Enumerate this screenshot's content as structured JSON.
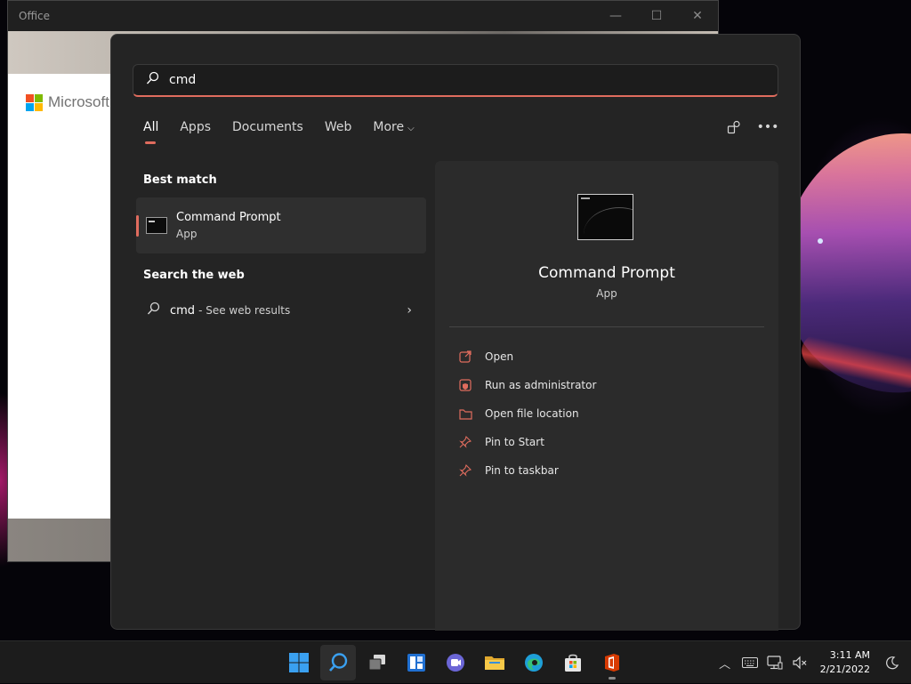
{
  "office_window": {
    "title": "Office",
    "brand": "Microsoft",
    "logo_colors": [
      "#f25022",
      "#7fba00",
      "#00a4ef",
      "#ffb900"
    ]
  },
  "search": {
    "query": "cmd",
    "tabs": [
      {
        "label": "All",
        "active": true
      },
      {
        "label": "Apps",
        "active": false
      },
      {
        "label": "Documents",
        "active": false
      },
      {
        "label": "Web",
        "active": false
      },
      {
        "label": "More",
        "active": false
      }
    ],
    "top_icons": [
      "share-icon",
      "more-options-icon"
    ],
    "best_match": {
      "heading": "Best match",
      "name": "Command Prompt",
      "type": "App",
      "icon": "command-prompt-icon"
    },
    "web": {
      "heading": "Search the web",
      "query": "cmd",
      "suffix": "- See web results"
    },
    "detail": {
      "name": "Command Prompt",
      "type": "App",
      "actions": [
        {
          "label": "Open",
          "icon": "open-icon"
        },
        {
          "label": "Run as administrator",
          "icon": "admin-shield-icon"
        },
        {
          "label": "Open file location",
          "icon": "folder-icon"
        },
        {
          "label": "Pin to Start",
          "icon": "pin-icon"
        },
        {
          "label": "Pin to taskbar",
          "icon": "pin-icon"
        }
      ]
    },
    "accent_color": "#e06c5e"
  },
  "taskbar": {
    "apps": [
      {
        "name": "start-button",
        "icon": "windows-icon"
      },
      {
        "name": "search-button",
        "icon": "search-icon",
        "active": true
      },
      {
        "name": "task-view-button",
        "icon": "task-view-icon"
      },
      {
        "name": "widgets-button",
        "icon": "widgets-icon"
      },
      {
        "name": "teams-chat-button",
        "icon": "chat-icon"
      },
      {
        "name": "file-explorer-button",
        "icon": "folder-icon"
      },
      {
        "name": "edge-button",
        "icon": "edge-icon"
      },
      {
        "name": "store-button",
        "icon": "store-icon"
      },
      {
        "name": "office-button",
        "icon": "office-icon",
        "running": true
      }
    ],
    "tray": {
      "icons": [
        "chevron-up-icon",
        "keyboard-icon",
        "network-icon",
        "volume-muted-icon",
        "focus-assist-icon"
      ],
      "time": "3:11 AM",
      "date": "2/21/2022"
    }
  }
}
